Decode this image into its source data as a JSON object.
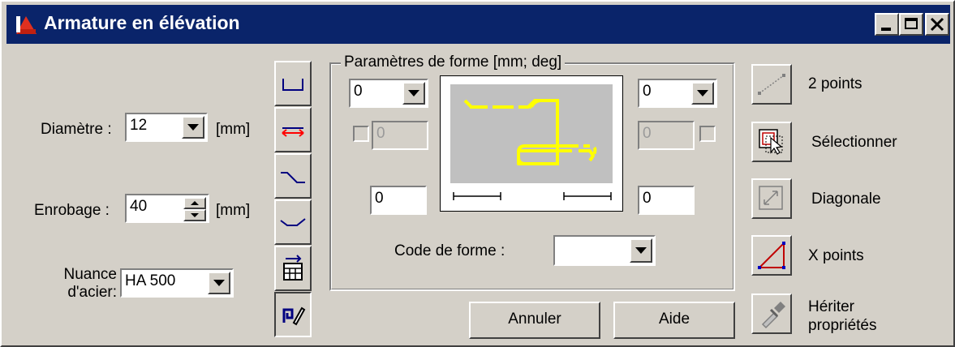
{
  "window": {
    "title": "Armature en élévation"
  },
  "left": {
    "diametre": {
      "label": "Diamètre :",
      "value": "12",
      "unit": "[mm]"
    },
    "enrobage": {
      "label": "Enrobage :",
      "value": "40",
      "unit": "[mm]"
    },
    "nuance": {
      "label_line1": "Nuance",
      "label_line2": "d'acier:",
      "value": "HA 500"
    }
  },
  "params": {
    "group_label": "Paramètres de forme [mm; deg]",
    "top_left_combo": "0",
    "top_right_combo": "0",
    "left_disabled_field": "0",
    "right_disabled_field": "0",
    "bottom_left_field": "0",
    "bottom_right_field": "0",
    "code_label": "Code de forme :",
    "code_value": ""
  },
  "buttons": {
    "annuler": "Annuler",
    "aide": "Aide"
  },
  "right_tools": [
    {
      "label": "2 points",
      "icon": "two-points-icon"
    },
    {
      "label": "Sélectionner",
      "icon": "select-icon"
    },
    {
      "label": "Diagonale",
      "icon": "diagonal-icon"
    },
    {
      "label": "X points",
      "icon": "x-points-icon"
    },
    {
      "label_line1": "Hériter",
      "label_line2": "propriétés",
      "icon": "eyedropper-icon"
    }
  ],
  "shape_preview_color": "#ffff00"
}
